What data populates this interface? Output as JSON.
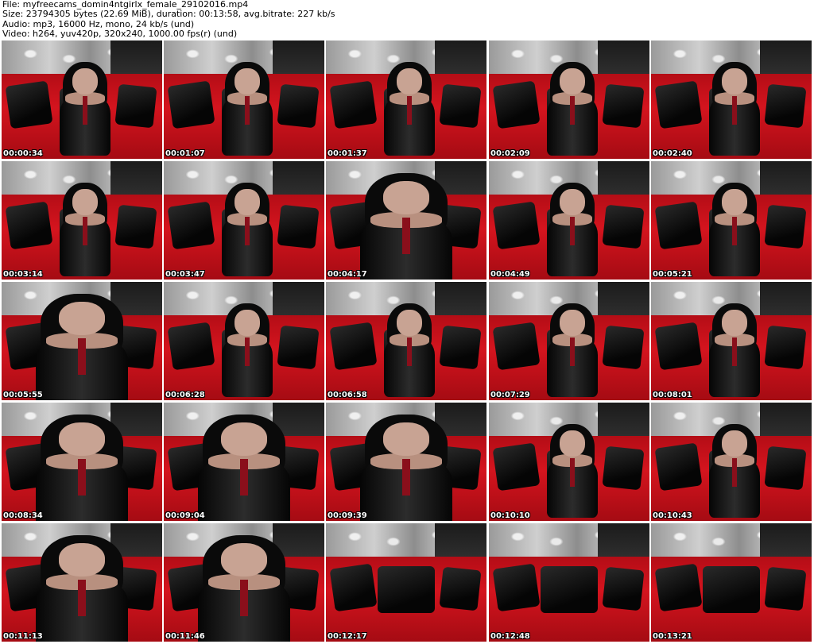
{
  "header": {
    "file_line": "File: myfreecams_domin4ntgirlx_female_29102016.mp4",
    "size_line": "Size: 23794305 bytes (22.69 MiB), duration: 00:13:58, avg.bitrate: 227 kb/s",
    "audio_line": "Audio: mp3, 16000 Hz, mono, 24 kb/s (und)",
    "video_line": "Video: h264, yuv420p, 320x240, 1000.00 fps(r) (und)"
  },
  "thumbnails": [
    {
      "timestamp": "00:00:34",
      "scene": "seated"
    },
    {
      "timestamp": "00:01:07",
      "scene": "seated"
    },
    {
      "timestamp": "00:01:37",
      "scene": "seated"
    },
    {
      "timestamp": "00:02:09",
      "scene": "seated"
    },
    {
      "timestamp": "00:02:40",
      "scene": "seated"
    },
    {
      "timestamp": "00:03:14",
      "scene": "seated"
    },
    {
      "timestamp": "00:03:47",
      "scene": "seated"
    },
    {
      "timestamp": "00:04:17",
      "scene": "close"
    },
    {
      "timestamp": "00:04:49",
      "scene": "seated"
    },
    {
      "timestamp": "00:05:21",
      "scene": "seated"
    },
    {
      "timestamp": "00:05:55",
      "scene": "close"
    },
    {
      "timestamp": "00:06:28",
      "scene": "seated"
    },
    {
      "timestamp": "00:06:58",
      "scene": "seated"
    },
    {
      "timestamp": "00:07:29",
      "scene": "seated"
    },
    {
      "timestamp": "00:08:01",
      "scene": "seated"
    },
    {
      "timestamp": "00:08:34",
      "scene": "close"
    },
    {
      "timestamp": "00:09:04",
      "scene": "close"
    },
    {
      "timestamp": "00:09:39",
      "scene": "close"
    },
    {
      "timestamp": "00:10:10",
      "scene": "seated"
    },
    {
      "timestamp": "00:10:43",
      "scene": "seated"
    },
    {
      "timestamp": "00:11:13",
      "scene": "close"
    },
    {
      "timestamp": "00:11:46",
      "scene": "close"
    },
    {
      "timestamp": "00:12:17",
      "scene": "empty"
    },
    {
      "timestamp": "00:12:48",
      "scene": "empty"
    },
    {
      "timestamp": "00:13:21",
      "scene": "empty"
    }
  ]
}
